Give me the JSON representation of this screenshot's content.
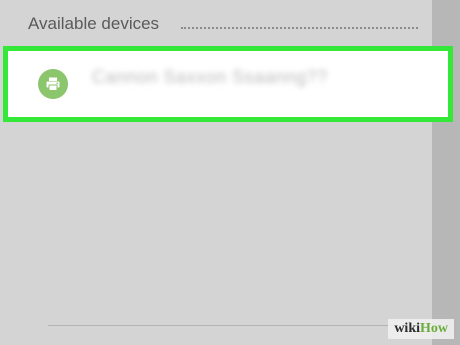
{
  "section": {
    "title": "Available devices"
  },
  "device": {
    "name": "Cannon Saxxon Ssaanng??",
    "icon": "printer-icon"
  },
  "watermark": {
    "prefix": "wiki",
    "suffix": "How"
  },
  "colors": {
    "background": "#d4d4d4",
    "highlight_border": "#34e83a",
    "icon_bg": "#8bc56c",
    "row_bg": "#ffffff"
  }
}
